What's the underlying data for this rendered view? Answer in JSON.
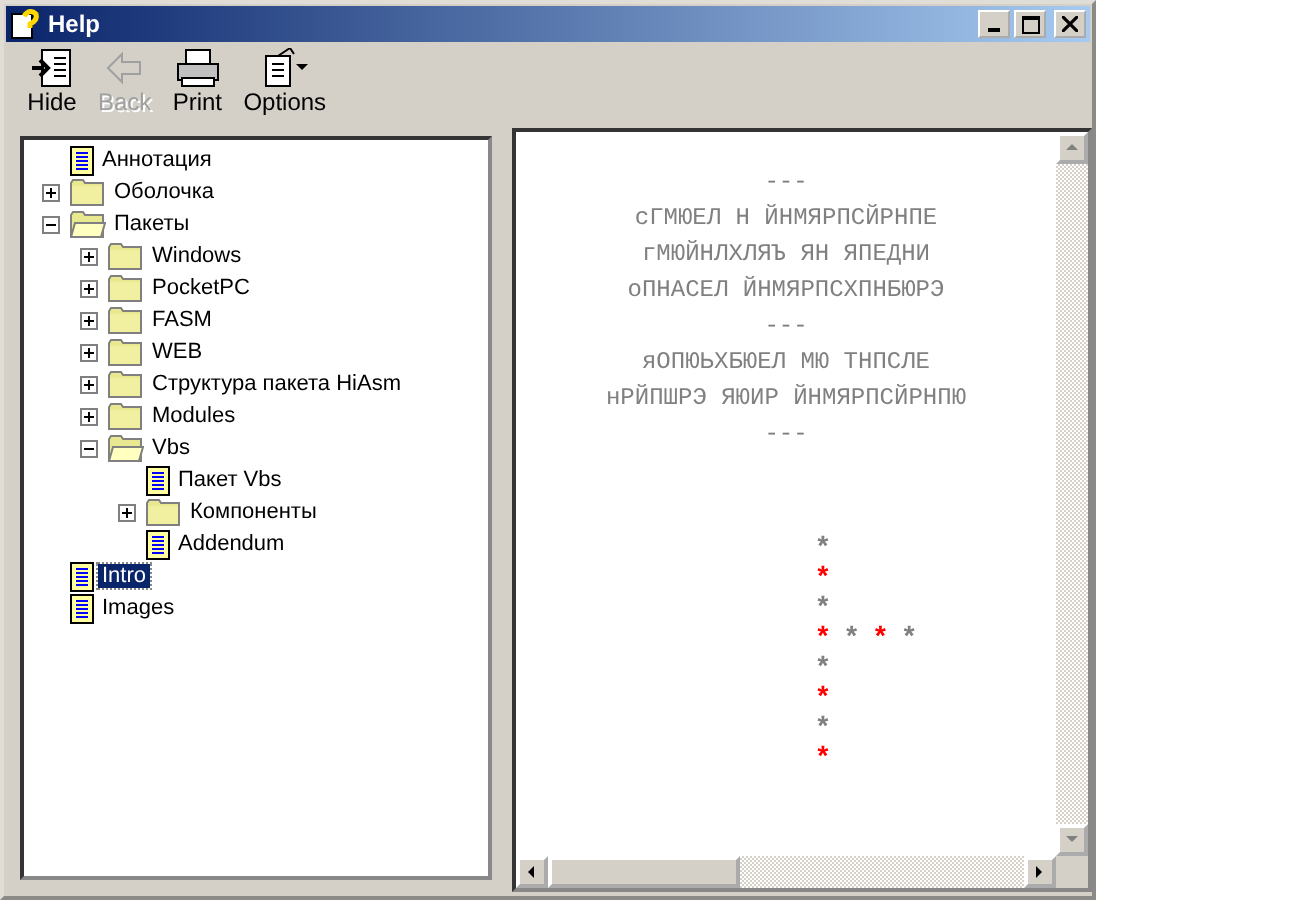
{
  "window": {
    "title": "Help"
  },
  "toolbar": [
    {
      "label": "Hide",
      "kind": "hide",
      "disabled": false
    },
    {
      "label": "Back",
      "kind": "back",
      "disabled": true
    },
    {
      "label": "Print",
      "kind": "print",
      "disabled": false
    },
    {
      "label": "Options",
      "kind": "options",
      "disabled": false
    }
  ],
  "tree": [
    {
      "label": "Аннотация",
      "kind": "doc",
      "selected": false
    },
    {
      "label": "Оболочка",
      "kind": "folder",
      "expanded": false,
      "selected": false
    },
    {
      "label": "Пакеты",
      "kind": "folder",
      "expanded": true,
      "selected": false,
      "children": [
        {
          "label": "Windows",
          "kind": "folder",
          "expanded": false,
          "selected": false
        },
        {
          "label": "PocketPC",
          "kind": "folder",
          "expanded": false,
          "selected": false
        },
        {
          "label": "FASM",
          "kind": "folder",
          "expanded": false,
          "selected": false
        },
        {
          "label": "WEB",
          "kind": "folder",
          "expanded": false,
          "selected": false
        },
        {
          "label": "Структура пакета HiAsm",
          "kind": "folder",
          "expanded": false,
          "selected": false
        },
        {
          "label": "Modules",
          "kind": "folder",
          "expanded": false,
          "selected": false
        },
        {
          "label": "Vbs",
          "kind": "folder",
          "expanded": true,
          "selected": false,
          "children": [
            {
              "label": "Пакет Vbs",
              "kind": "doc",
              "selected": false
            },
            {
              "label": "Компоненты",
              "kind": "folder",
              "expanded": false,
              "selected": false
            },
            {
              "label": "Addendum",
              "kind": "doc",
              "selected": false
            }
          ]
        }
      ]
    },
    {
      "label": "Intro",
      "kind": "doc",
      "selected": true
    },
    {
      "label": "Images",
      "kind": "doc",
      "selected": false
    }
  ],
  "content": {
    "lines": [
      "---",
      "сГМЮЕЛ Н ЙНМЯРПСЙРНПЕ",
      "гМЮЙНЛХЛЯЪ ЯН ЯПЕДНИ",
      "оПНАСЕЛ ЙНМЯРПСХПНБЮРЭ",
      "---",
      "яОПЮЬХБЮЕЛ МЮ ТНПСЛЕ",
      "нРЙПШРЭ ЯЮИР ЙНМЯРПСЙРНПЮ",
      "---"
    ],
    "stars": [
      {
        "text": "*",
        "color": "#808080"
      },
      {
        "text": "*",
        "color": "#ff0000"
      },
      {
        "text": "*",
        "color": "#808080"
      },
      {
        "text": "*",
        "color": "#ff0000"
      },
      {
        "text": "*",
        "color": "#808080"
      },
      {
        "text": "*",
        "color": "#ff0000"
      },
      {
        "text": "*",
        "color": "#808080"
      },
      {
        "text": "*",
        "color": "#ff0000"
      }
    ],
    "star_row": [
      {
        "text": "*",
        "color": "#808080"
      },
      {
        "text": "*",
        "color": "#ff0000"
      },
      {
        "text": "*",
        "color": "#808080"
      }
    ]
  }
}
